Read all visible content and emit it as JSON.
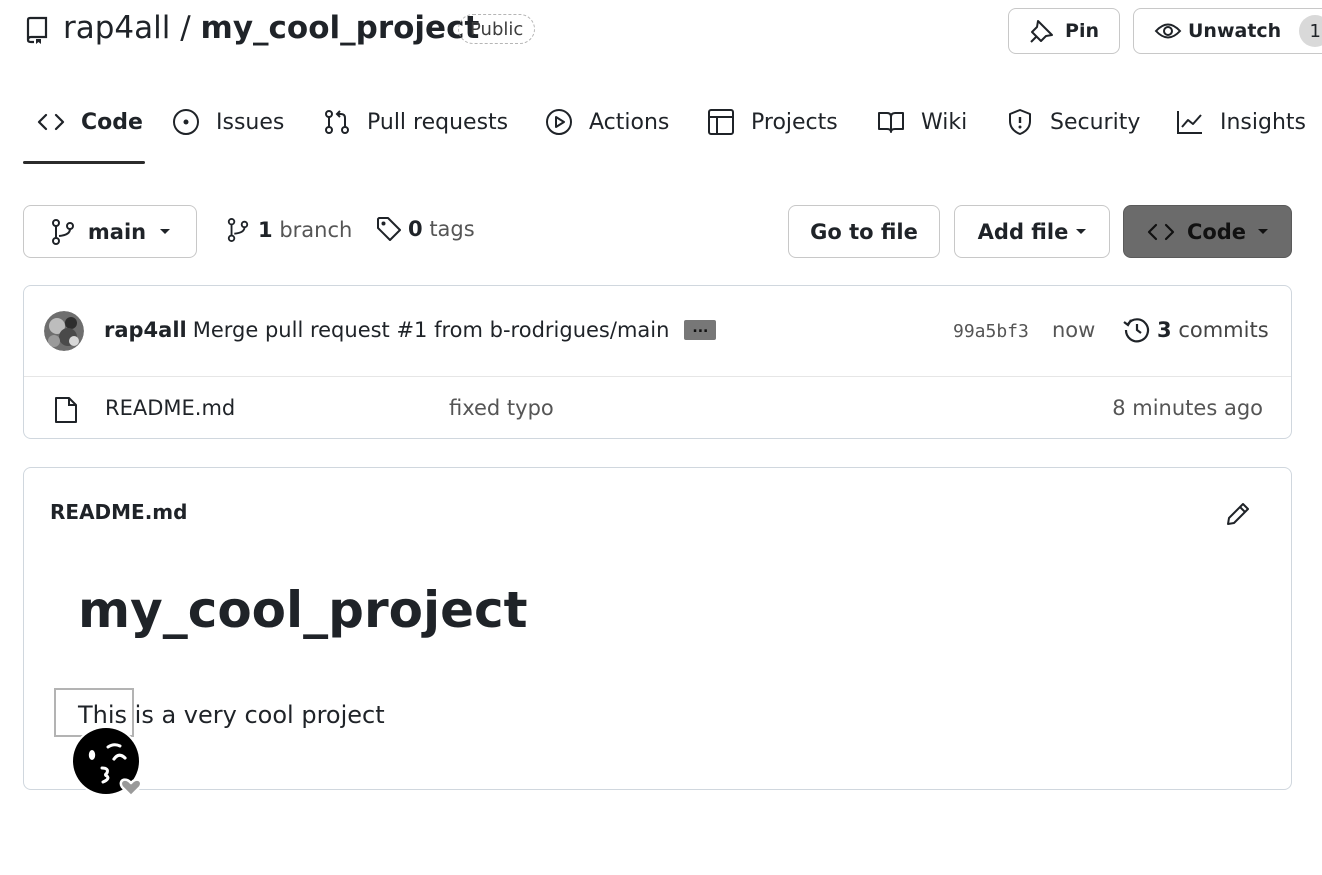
{
  "header": {
    "owner": "rap4all",
    "separator": " / ",
    "repo": "my_cool_project",
    "visibility": "Public",
    "pin_label": "Pin",
    "watch_label": "Unwatch",
    "watch_count": "1"
  },
  "tabs": [
    {
      "label": "Code",
      "icon": "code-icon",
      "active": true
    },
    {
      "label": "Issues",
      "icon": "issue-icon"
    },
    {
      "label": "Pull requests",
      "icon": "pull-request-icon"
    },
    {
      "label": "Actions",
      "icon": "play-icon"
    },
    {
      "label": "Projects",
      "icon": "table-icon"
    },
    {
      "label": "Wiki",
      "icon": "book-icon"
    },
    {
      "label": "Security",
      "icon": "shield-icon"
    },
    {
      "label": "Insights",
      "icon": "graph-icon"
    }
  ],
  "toolbar": {
    "branch": "main",
    "branch_count": "1",
    "branch_word": "branch",
    "tag_count": "0",
    "tag_word": "tags",
    "goto_label": "Go to file",
    "add_file_label": "Add file",
    "code_label": "Code"
  },
  "commit": {
    "author": "rap4all",
    "message": "Merge pull request #1 from b-rodrigues/main",
    "ellipsis": "...",
    "sha": "99a5bf3",
    "time": "now",
    "count": "3",
    "count_word": "commits"
  },
  "files": [
    {
      "name": "README.md",
      "message": "fixed typo",
      "time": "8 minutes ago"
    }
  ],
  "readme": {
    "filename": "README.md",
    "heading": "my_cool_project",
    "body": "This is a very cool project"
  },
  "colors": {
    "border": "#d0d7de",
    "code_button_bg": "#6b6b6b",
    "tab_underline": "#2b2b2b"
  }
}
